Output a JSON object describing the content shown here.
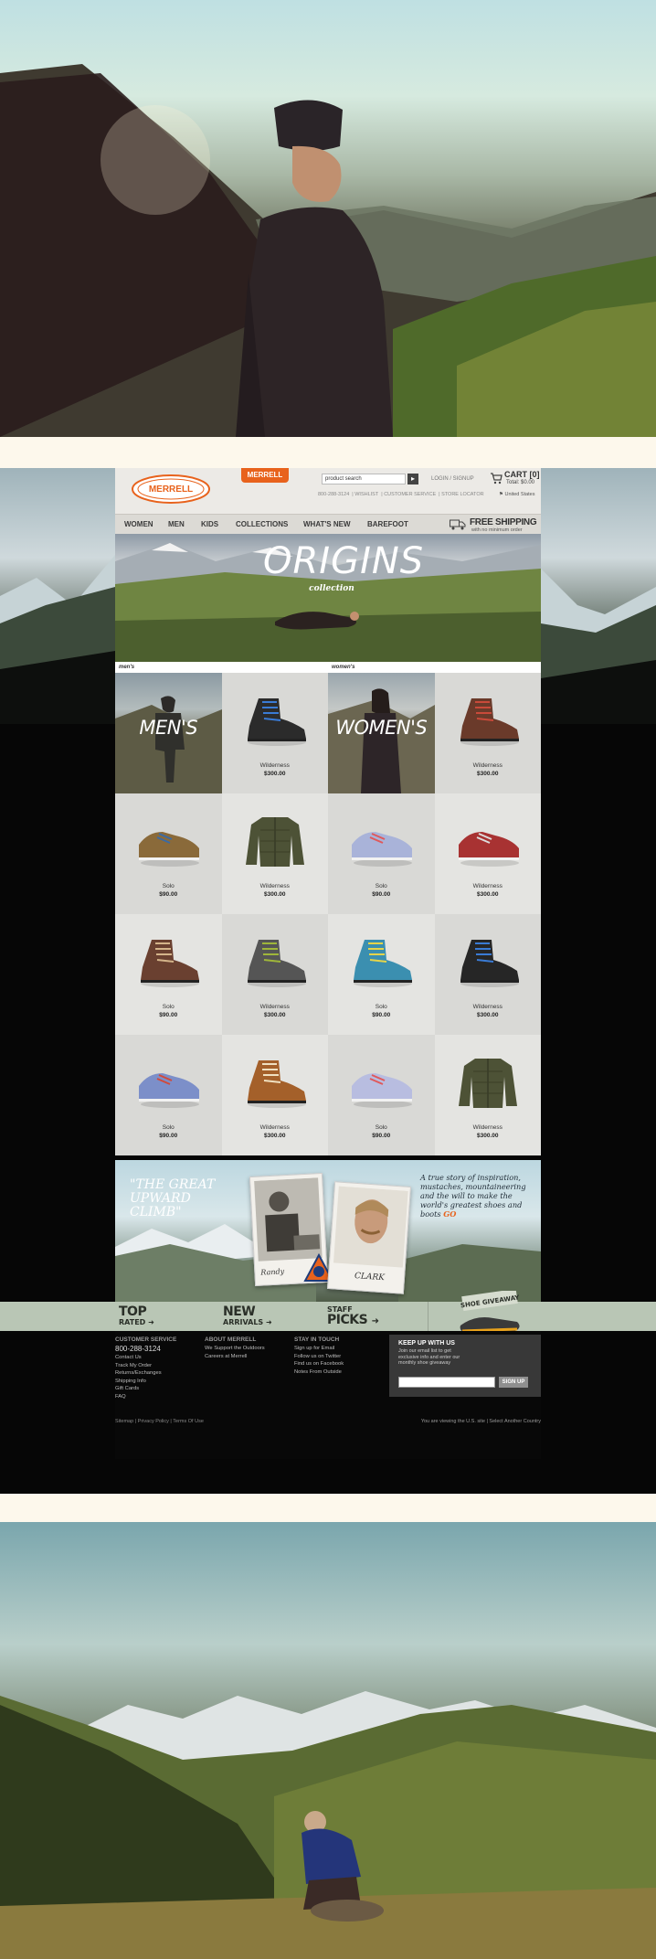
{
  "header": {
    "logo_text": "MERRELL",
    "badge_label": "MERRELL",
    "search_value": "product search",
    "login_label": "LOGIN / SIGNUP",
    "cart_label": "CART [0]",
    "total_label": "Total: $0.00",
    "utility_links": [
      "800-288-3124",
      "WISHLIST",
      "CUSTOMER SERVICE",
      "STORE LOCATOR"
    ],
    "region_label": "United States"
  },
  "nav": {
    "items": [
      "WOMEN",
      "MEN",
      "KIDS",
      "COLLECTIONS",
      "WHAT'S NEW",
      "BAREFOOT"
    ],
    "shipping_title": "FREE SHIPPING",
    "shipping_sub": "with no minimum order"
  },
  "banner": {
    "title": "ORIGINS",
    "subtitle": "collection"
  },
  "grid": {
    "mens_header": "men's",
    "womens_header": "women's",
    "mens_promo": "MEN'S",
    "womens_promo": "WOMEN'S",
    "products": [
      {
        "name": "Wilderness",
        "price": "$300.00",
        "color": "#2b2b2b",
        "lace": "#3a7bd5",
        "type": "boot"
      },
      {
        "name": "Wilderness",
        "price": "$300.00",
        "color": "#6a3a2a",
        "lace": "#c94a3a",
        "type": "boot"
      },
      {
        "name": "Solo",
        "price": "$90.00",
        "color": "#8a6a3a",
        "lace": "#3a6aa5",
        "type": "shoe"
      },
      {
        "name": "Wilderness",
        "price": "$300.00",
        "color": "#4d5236",
        "lace": "#4d5236",
        "type": "jacket"
      },
      {
        "name": "Solo",
        "price": "$90.00",
        "color": "#a9b3d9",
        "lace": "#e0585a",
        "type": "shoe"
      },
      {
        "name": "Wilderness",
        "price": "$300.00",
        "color": "#a83232",
        "lace": "#ddd",
        "type": "shoe"
      },
      {
        "name": "Solo",
        "price": "$90.00",
        "color": "#6a4030",
        "lace": "#d4b48a",
        "type": "boot"
      },
      {
        "name": "Wilderness",
        "price": "$300.00",
        "color": "#555555",
        "lace": "#9fb63a",
        "type": "boot"
      },
      {
        "name": "Solo",
        "price": "$90.00",
        "color": "#3b8fb0",
        "lace": "#e5d44a",
        "type": "boot"
      },
      {
        "name": "Wilderness",
        "price": "$300.00",
        "color": "#262626",
        "lace": "#3a7bd5",
        "type": "boot"
      },
      {
        "name": "Solo",
        "price": "$90.00",
        "color": "#7c8fc9",
        "lace": "#d24a3a",
        "type": "shoe"
      },
      {
        "name": "Wilderness",
        "price": "$300.00",
        "color": "#a4602a",
        "lace": "#f0e0c0",
        "type": "boot"
      },
      {
        "name": "Solo",
        "price": "$90.00",
        "color": "#b8bde0",
        "lace": "#e0585a",
        "type": "shoe"
      },
      {
        "name": "Wilderness",
        "price": "$300.00",
        "color": "#4d5236",
        "lace": "#4d5236",
        "type": "jacket"
      }
    ]
  },
  "story": {
    "quote": "\"THE GREAT UPWARD CLIMB\"",
    "text": "A true story of inspiration, mustaches, mountaineering and the will to make the world's greatest shoes and boots",
    "go_label": "GO",
    "caption_left": "Randy",
    "caption_right": "CLARK"
  },
  "strip": {
    "top_big": "TOP",
    "top_small": "RATED",
    "new_big": "NEW",
    "new_small": "ARRIVALS",
    "staff_small": "STAFF",
    "staff_big": "PICKS",
    "giveaway_label": "SHOE GIVEAWAY"
  },
  "footer": {
    "customer_service": {
      "heading": "CUSTOMER SERVICE",
      "phone": "800-288-3124",
      "links": [
        "Contact Us",
        "Track My Order",
        "Returns/Exchanges",
        "Shipping Info",
        "Gift Cards",
        "FAQ"
      ]
    },
    "about": {
      "heading": "ABOUT MERRELL",
      "links": [
        "We Support the Outdoors",
        "Careers at Merrell"
      ]
    },
    "stay": {
      "heading": "STAY IN TOUCH",
      "links": [
        "Sign up for Email",
        "Follow us on Twitter",
        "Find us on Facebook",
        "Notes From Outside"
      ]
    },
    "signup": {
      "title": "KEEP UP WITH US",
      "copy": "Join our email list to get exclusive info and enter our monthly shoe giveaway",
      "button": "SIGN UP"
    },
    "legal": "Sitemap | Privacy Policy | Terms Of Use",
    "viewing": "You are viewing the U.S. site | Select Another Country"
  },
  "colors": {
    "brand_orange": "#e8621c",
    "footer_bg": "#080808",
    "strip_bg": "#b9c6b5"
  }
}
